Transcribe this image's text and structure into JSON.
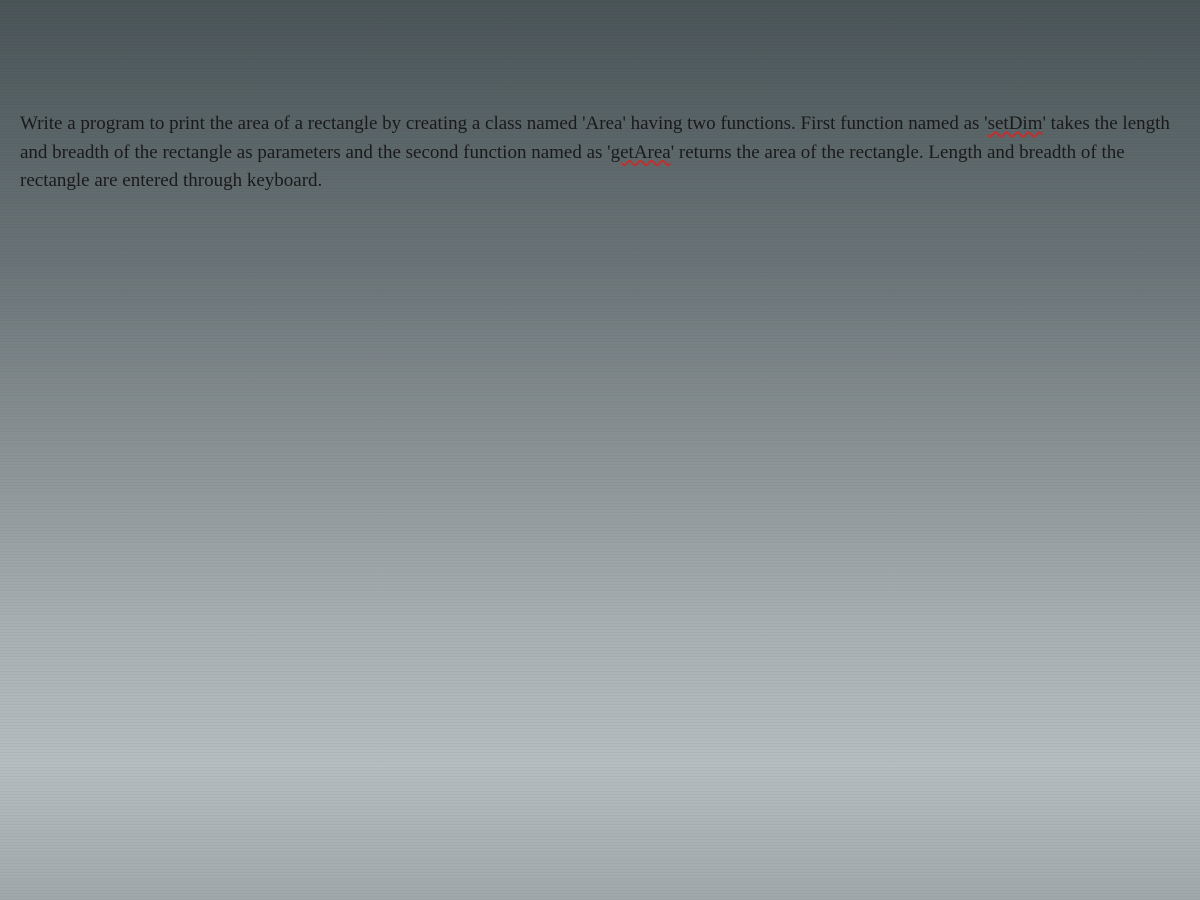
{
  "document": {
    "text_part1": "Write a program to print the area of a rectangle by creating a class named 'Area' having two functions. First function named as '",
    "spell_error1": "setDim",
    "text_part2": "' takes the length and breadth of the rectangle as parameters and the second function named as '",
    "spell_error2": "getArea",
    "text_part3": "' returns the area of the rectangle. Length and breadth of the rectangle are entered through keyboard."
  }
}
